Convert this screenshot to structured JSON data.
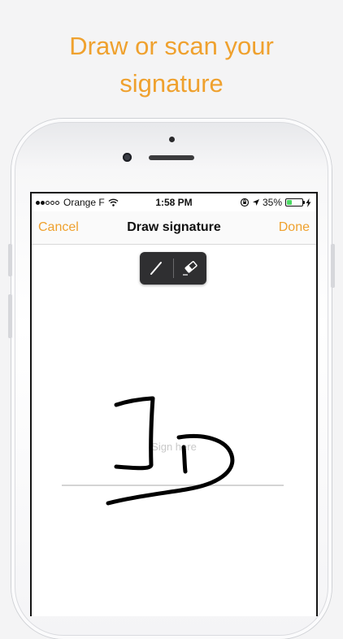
{
  "headline": {
    "line1": "Draw or scan your",
    "line2": "signature"
  },
  "status_bar": {
    "carrier": "Orange F",
    "time": "1:58 PM",
    "battery": "35%",
    "battery_level": 0.35,
    "signal_bars_filled": 2,
    "signal_bars_total": 5
  },
  "nav": {
    "cancel": "Cancel",
    "title": "Draw signature",
    "done": "Done"
  },
  "toolbar": {
    "tools": [
      "pen-icon",
      "eraser-icon"
    ]
  },
  "canvas": {
    "placeholder": "Sign here",
    "signature_text": "JD"
  },
  "colors": {
    "accent": "#efa12e",
    "toolbar_bg": "#2f2f31",
    "battery_fill": "#4cd964"
  }
}
